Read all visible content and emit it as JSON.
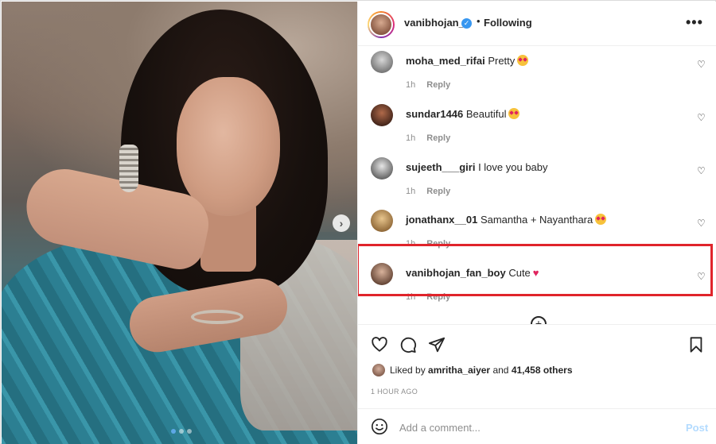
{
  "post": {
    "username": "vanibhojan_",
    "separator": "•",
    "follow_status": "Following",
    "more_label": "•••"
  },
  "carousel": {
    "next_label": "›",
    "slides": 3,
    "active_slide": 1
  },
  "comments": [
    {
      "username": "moha_med_rifai",
      "text": "Pretty",
      "emoji": "heart-eyes-emoji",
      "time": "1h",
      "reply": "Reply"
    },
    {
      "username": "sundar1446",
      "text": "Beautiful",
      "emoji": "heart-eyes-emoji",
      "time": "1h",
      "reply": "Reply"
    },
    {
      "username": "sujeeth___giri",
      "text": "I love you baby",
      "emoji": "",
      "time": "1h",
      "reply": "Reply"
    },
    {
      "username": "jonathanx__01",
      "text": "Samantha + Nayanthara",
      "emoji": "heart-eyes-emoji",
      "time": "1h",
      "reply": "Reply",
      "highlighted": true
    },
    {
      "username": "vanibhojan_fan_boy",
      "text": "Cute",
      "emoji": "red-heart-emoji",
      "time": "1h",
      "reply": "Reply"
    }
  ],
  "likes": {
    "prefix": "Liked by",
    "user": "amritha_aiyer",
    "middle": "and",
    "count": "41,458 others"
  },
  "timestamp": "1 HOUR AGO",
  "add_comment": {
    "placeholder": "Add a comment...",
    "post_label": "Post"
  },
  "colors": {
    "highlight": "#e0242b",
    "verified": "#3897f0",
    "post_disabled": "#b3dbff",
    "muted": "#8e8e8e"
  }
}
